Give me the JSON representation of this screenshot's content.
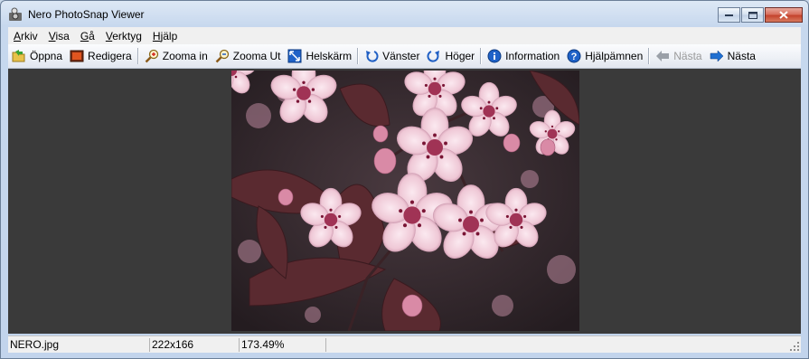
{
  "window": {
    "title": "Nero PhotoSnap Viewer"
  },
  "menu": [
    {
      "key": "A",
      "rest": "rkiv"
    },
    {
      "key": "V",
      "rest": "isa"
    },
    {
      "key": "G",
      "rest": "å"
    },
    {
      "key": "V",
      "rest": "erktyg"
    },
    {
      "key": "H",
      "rest": "jälp"
    }
  ],
  "toolbar": {
    "open": "Öppna",
    "edit": "Redigera",
    "zoom_in": "Zooma in",
    "zoom_out": "Zooma Ut",
    "fullscreen": "Helskärm",
    "rotate_left": "Vänster",
    "rotate_right": "Höger",
    "information": "Information",
    "help": "Hjälpämnen",
    "previous": "Nästa",
    "next": "Nästa"
  },
  "status": {
    "filename": "NERO.jpg",
    "dimensions": "222x166",
    "zoom": "173.49%"
  },
  "colors": {
    "viewer_background": "#3a3a3a",
    "accent_blue": "#1f6fd1"
  }
}
